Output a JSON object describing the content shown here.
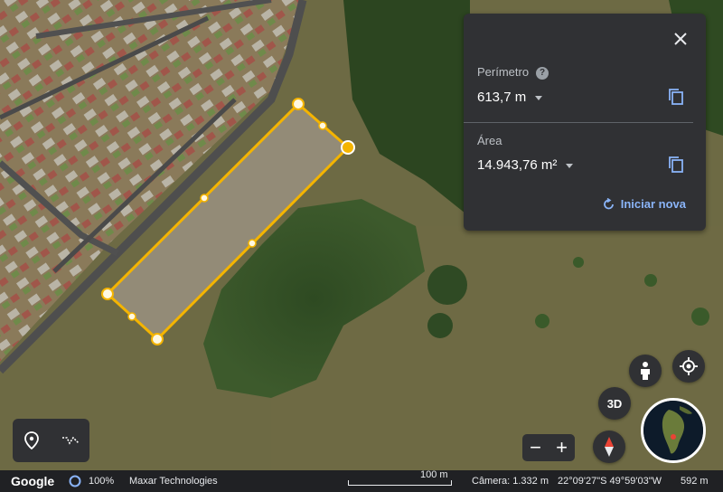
{
  "measure_panel": {
    "perimeter_label": "Perímetro",
    "perimeter_value": "613,7 m",
    "area_label": "Área",
    "area_value": "14.943,76 m²",
    "restart_label": "Iniciar nova"
  },
  "map_controls": {
    "mode_3d": "3D"
  },
  "status_bar": {
    "logo": "Google",
    "load_percent": "100%",
    "attribution": "Maxar Technologies",
    "scale": "100 m",
    "camera": "Câmera: 1.332 m",
    "coordinates": "22°09'27\"S 49°59'03\"W",
    "elevation": "592 m"
  },
  "colors": {
    "panel_bg": "#303134",
    "accent": "#8ab4f8",
    "polygon": "#f4b400"
  }
}
